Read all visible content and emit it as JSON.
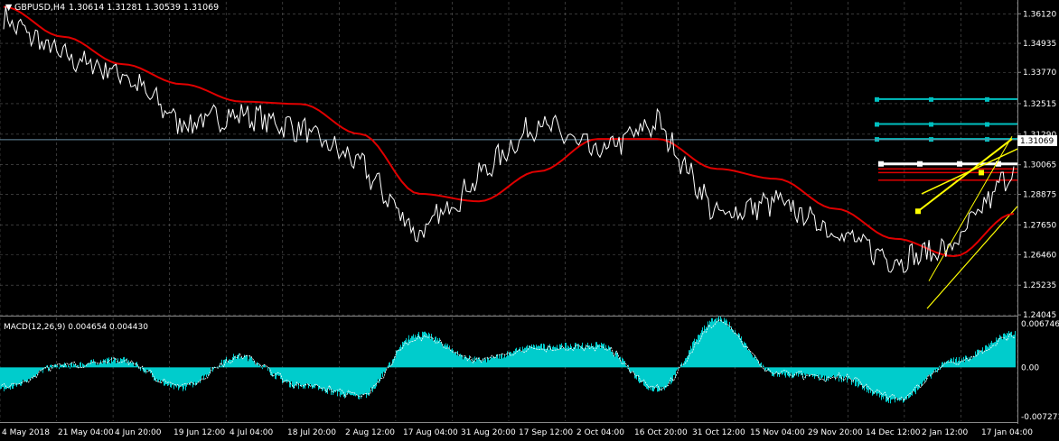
{
  "header": {
    "symbol": "GBPUSD,H4",
    "ohlc": "1.30614 1.31281 1.30539 1.31069",
    "dropdown_icon": "triangle-down-icon"
  },
  "colors": {
    "background": "#000000",
    "grid": "#5a5a5a",
    "price_line": "#ffffff",
    "ma": "#e00000",
    "trend_yellow": "#ffff00",
    "fib_cyan": "#00c0c0",
    "macd_hist": "#00cccc",
    "macd_signal": "#ffffff"
  },
  "chart_data": [
    {
      "type": "line",
      "title": "GBPUSD,H4",
      "series": [
        {
          "name": "GBPUSD",
          "x": [
            "4 May 2018",
            "21 May 04:00",
            "4 Jun 20:00",
            "19 Jun 12:00",
            "4 Jul 04:00",
            "18 Jul 20:00",
            "2 Aug 12:00",
            "17 Aug 04:00",
            "31 Aug 20:00",
            "17 Sep 12:00",
            "2 Oct 04:00",
            "16 Oct 20:00",
            "31 Oct 12:00",
            "15 Nov 04:00",
            "29 Nov 20:00",
            "14 Dec 12:00",
            "2 Jan 12:00",
            "17 Jan 04:00"
          ],
          "values": [
            1.3595,
            1.344,
            1.3375,
            1.317,
            1.321,
            1.315,
            1.301,
            1.272,
            1.296,
            1.318,
            1.305,
            1.318,
            1.28,
            1.286,
            1.274,
            1.262,
            1.268,
            1.3
          ]
        },
        {
          "name": "",
          "x": [
            "4 May 2018",
            "21 May 04:00",
            "4 Jun 20:00",
            "19 Jun 12:00",
            "4 Jul 04:00",
            "18 Jul 20:00",
            "2 Aug 12:00",
            "17 Aug 04:00",
            "31 Aug 20:00",
            "17 Sep 12:00",
            "2 Oct 04:00",
            "16 Oct 20:00",
            "31 Oct 12:00",
            "15 Nov 04:00",
            "29 Nov 20:00",
            "14 Dec 12:00",
            "2 Jan 12:00",
            "17 Jan 04:00"
          ],
          "values": [
            1.364,
            1.352,
            1.341,
            1.333,
            1.326,
            1.325,
            1.313,
            1.289,
            1.286,
            1.298,
            1.311,
            1.311,
            1.299,
            1.295,
            1.283,
            1.271,
            1.264,
            1.281
          ]
        }
      ],
      "y_ticks": [
        "1.36120",
        "1.34935",
        "1.33770",
        "1.32515",
        "1.31290",
        "1.30065",
        "1.28875",
        "1.27650",
        "1.26460",
        "1.25235",
        "1.24045"
      ],
      "ylim": [
        1.2405,
        1.366
      ],
      "x_tick_labels": [
        "4 May 2018",
        "21 May 04:00",
        "4 Jun 20:00",
        "19 Jun 12:00",
        "4 Jul 04:00",
        "18 Jul 20:00",
        "2 Aug 12:00",
        "17 Aug 04:00",
        "31 Aug 20:00",
        "17 Sep 12:00",
        "2 Oct 04:00",
        "16 Oct 20:00",
        "31 Oct 12:00",
        "15 Nov 04:00",
        "29 Nov 20:00",
        "14 Dec 12:00",
        "2 Jan 12:00",
        "17 Jan 04:00"
      ],
      "current_price": "1.31069",
      "grid": true,
      "annotations": {
        "cyan_levels": [
          1.327,
          1.317,
          1.311
        ],
        "white_level": 1.301,
        "red_levels": [
          1.299,
          1.2975,
          1.2945
        ]
      }
    },
    {
      "type": "bar",
      "title": "MACD(12,26,9) 0.004654 0.004430",
      "series": [
        {
          "name": "MACD",
          "x": [
            "4 May 2018",
            "21 May 04:00",
            "4 Jun 20:00",
            "19 Jun 12:00",
            "4 Jul 04:00",
            "18 Jul 20:00",
            "2 Aug 12:00",
            "17 Aug 04:00",
            "31 Aug 20:00",
            "17 Sep 12:00",
            "2 Oct 04:00",
            "16 Oct 20:00",
            "31 Oct 12:00",
            "15 Nov 04:00",
            "29 Nov 20:00",
            "14 Dec 12:00",
            "2 Jan 12:00",
            "17 Jan 04:00"
          ],
          "values": [
            -0.003,
            0.0002,
            0.001,
            -0.0028,
            0.0015,
            -0.0025,
            -0.004,
            0.0045,
            0.001,
            0.0028,
            0.003,
            -0.003,
            0.0065,
            -0.001,
            -0.0015,
            -0.0045,
            0.001,
            0.0046
          ]
        }
      ],
      "y_ticks": [
        "0.006746",
        "0.00",
        "-0.007271"
      ],
      "ylim": [
        -0.007271,
        0.006746
      ]
    }
  ]
}
